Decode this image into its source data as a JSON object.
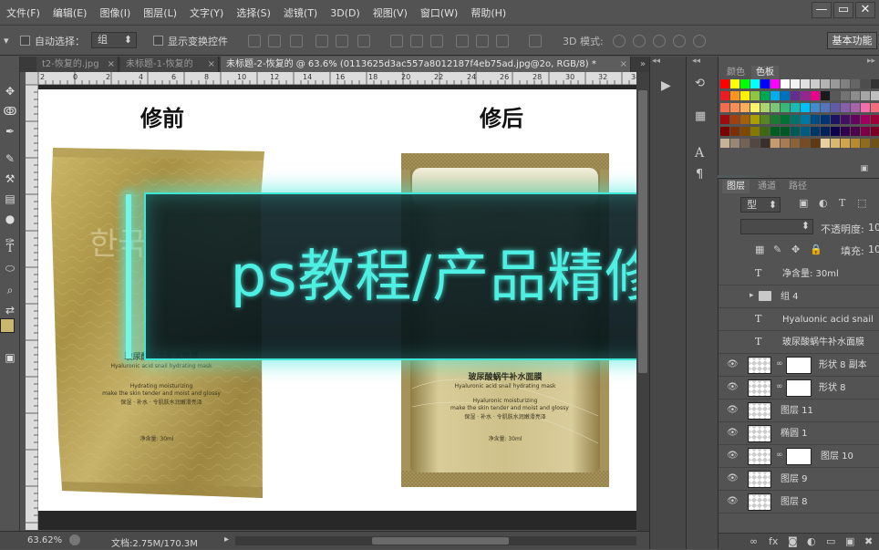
{
  "menu": [
    "文件(F)",
    "编辑(E)",
    "图像(I)",
    "图层(L)",
    "文字(Y)",
    "选择(S)",
    "滤镜(T)",
    "3D(D)",
    "视图(V)",
    "窗口(W)",
    "帮助(H)"
  ],
  "window_controls": [
    "—",
    "▭",
    "✕"
  ],
  "options": {
    "auto_select_label": "自动选择：",
    "auto_select_value": "组",
    "show_transform_label": "显示变换控件",
    "mode_3d_label": "3D 模式:",
    "workspace_button": "基本功能"
  },
  "tabs": [
    {
      "label": "t2-恢复的.jpg",
      "close": "×"
    },
    {
      "label": "未标题-1-恢复的",
      "close": "×"
    },
    {
      "label": "未标题-2-恢复的 @ 63.6% (0113625d3ac557a8012187f4eb75ad.jpg@2o, RGB/8) *",
      "close": "×"
    }
  ],
  "ruler_numbers": [
    "2",
    "0",
    "2",
    "4",
    "6",
    "8",
    "10",
    "12",
    "14",
    "16",
    "18",
    "20",
    "22",
    "24",
    "26",
    "28",
    "30",
    "32",
    "34"
  ],
  "canvas": {
    "before_label": "修前",
    "after_label": "修后",
    "banner_text": "ps教程/产品精修",
    "product_before": {
      "title": "玻尿酸蜗牛补水面膜",
      "subtitle": "Hyaluronic acid snail hydrating mask",
      "line1": "Hydrating moisturizing",
      "line2": "make the skin tender and moist and glossy",
      "line3": "保湿 · 补水 · 令肌肤水润嫩滑亮泽",
      "net": "净含量: 30ml",
      "deco": "한국"
    },
    "product_after": {
      "title": "玻尿酸蜗牛补水面膜",
      "subtitle": "Hyaluronic acid snail hydrating mask",
      "line1": "Hyaluronic moisturizing",
      "line2": "make the skin tender and moist and glossy",
      "line3": "保湿 · 补水 · 令肌肤水润嫩滑亮泽",
      "net": "净含量:     30ml"
    }
  },
  "status": {
    "zoom": "63.62%",
    "doc": "文档:2.75M/170.3M"
  },
  "panels": {
    "swatch_tabs": [
      "颜色",
      "色板"
    ],
    "layer_tabs": [
      "图层",
      "通道",
      "路径"
    ],
    "kind_label": "型",
    "opacity_label": "不透明度:",
    "opacity_value": "10",
    "fill_label": "填充:",
    "fill_value": "10",
    "layers": [
      {
        "name": "净含量: 30ml",
        "kind": "text"
      },
      {
        "name": "组 4",
        "kind": "group"
      },
      {
        "name": "Hyaluonic acid snail",
        "kind": "text"
      },
      {
        "name": "玻尿酸蜗牛补水面膜",
        "kind": "text"
      },
      {
        "name": "形状 8 副本",
        "kind": "shape"
      },
      {
        "name": "形状 8",
        "kind": "shape"
      },
      {
        "name": "图层 11",
        "kind": "pixel"
      },
      {
        "name": "椭圆 1",
        "kind": "pixel"
      },
      {
        "name": "图层 10",
        "kind": "masked"
      },
      {
        "name": "图层 9",
        "kind": "pixel"
      },
      {
        "name": "图层 8",
        "kind": "pixel"
      }
    ],
    "layer_bottom_icons": [
      "link-icon",
      "fx-icon",
      "mask-icon",
      "adjustment-icon",
      "folder-icon",
      "new-layer-icon",
      "trash-icon"
    ]
  },
  "colors": {
    "banner_text": "#4ff0e4",
    "banner_border": "#3fe6d8",
    "gold_before": "#b9a453",
    "gold_after": "#a6935a"
  }
}
